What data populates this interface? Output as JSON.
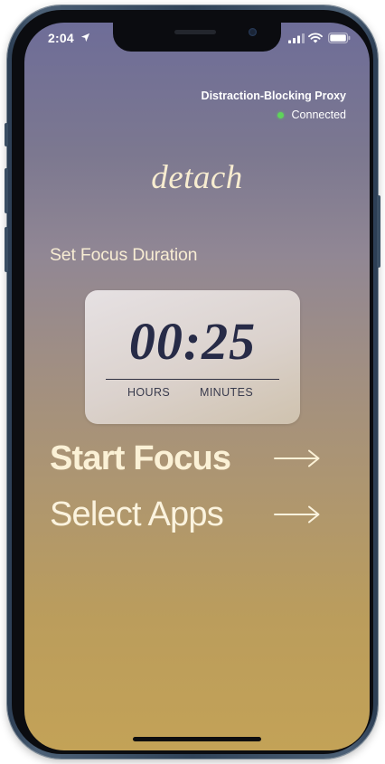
{
  "status_bar": {
    "time": "2:04",
    "location_icon": "location-arrow-icon",
    "signal_icon": "cellular-signal-icon",
    "wifi_icon": "wifi-icon",
    "battery_icon": "battery-icon"
  },
  "proxy": {
    "title": "Distraction-Blocking Proxy",
    "status": "Connected",
    "status_color": "#5ed45a"
  },
  "app": {
    "logo": "detach"
  },
  "focus": {
    "section_label": "Set Focus Duration",
    "timer_value": "00:25",
    "hours_label": "HOURS",
    "minutes_label": "MINUTES"
  },
  "actions": {
    "start_focus_label": "Start Focus",
    "select_apps_label": "Select Apps",
    "arrow_icon": "right-arrow-icon"
  },
  "colors": {
    "gradient_top": "#6e6d98",
    "gradient_bottom": "#c3a257",
    "text_cream": "#fbf1d6",
    "timer_text": "#272b47"
  }
}
